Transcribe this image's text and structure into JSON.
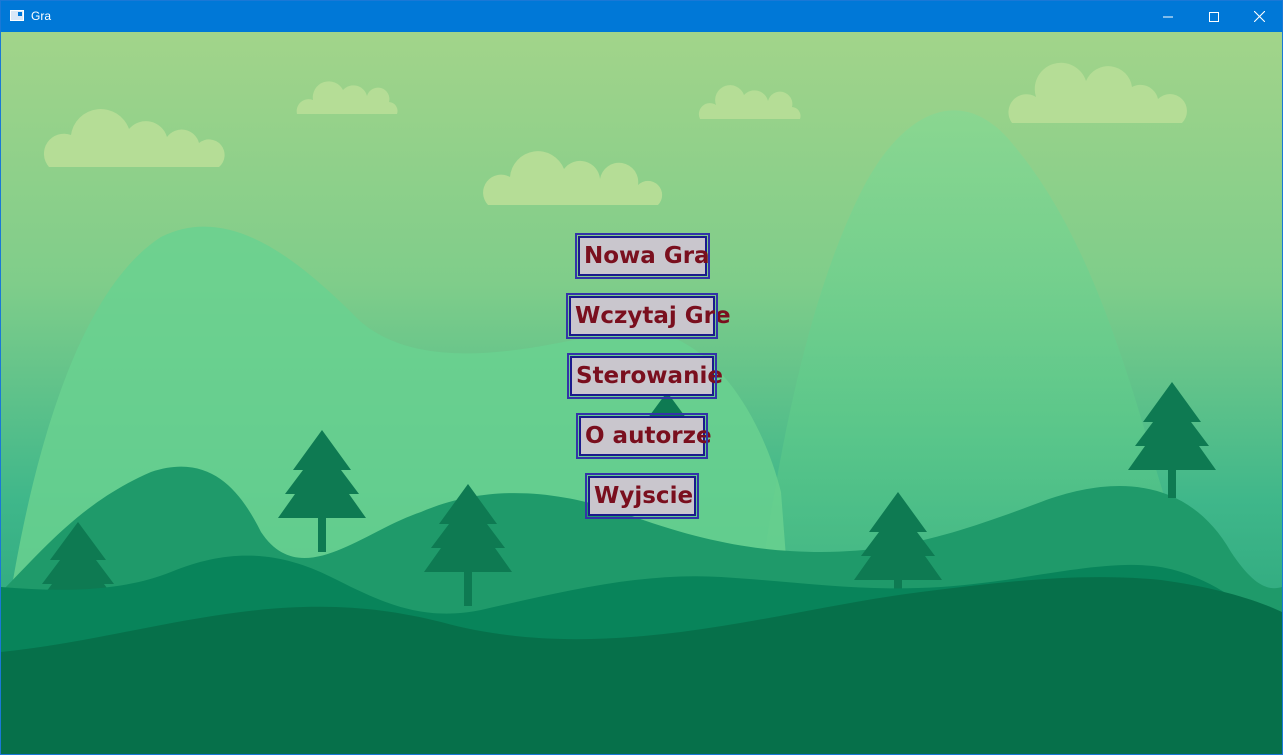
{
  "window": {
    "title": "Gra",
    "icon": "app-window-icon",
    "controls": {
      "minimize": "minimize-icon",
      "maximize": "maximize-icon",
      "close": "close-icon"
    },
    "titlebar_color": "#0078d7"
  },
  "menu": {
    "items": [
      {
        "label": "Nowa Gra"
      },
      {
        "label": "Wczytaj Gre"
      },
      {
        "label": "Sterowanie"
      },
      {
        "label": "O autorze"
      },
      {
        "label": "Wyjscie"
      }
    ],
    "button_bg": "#c9c6cd",
    "button_border": "#1a1a8c",
    "button_text_color": "#7a0f1e"
  },
  "scene": {
    "sky_top": "#a3d48a",
    "sky_bottom": "#3fb58a",
    "cloud_color": "#b7de97",
    "hill_colors": [
      "#6fd38e",
      "#1f9a6a",
      "#0a8458",
      "#077048"
    ],
    "tree_color": "#0f7a52"
  }
}
